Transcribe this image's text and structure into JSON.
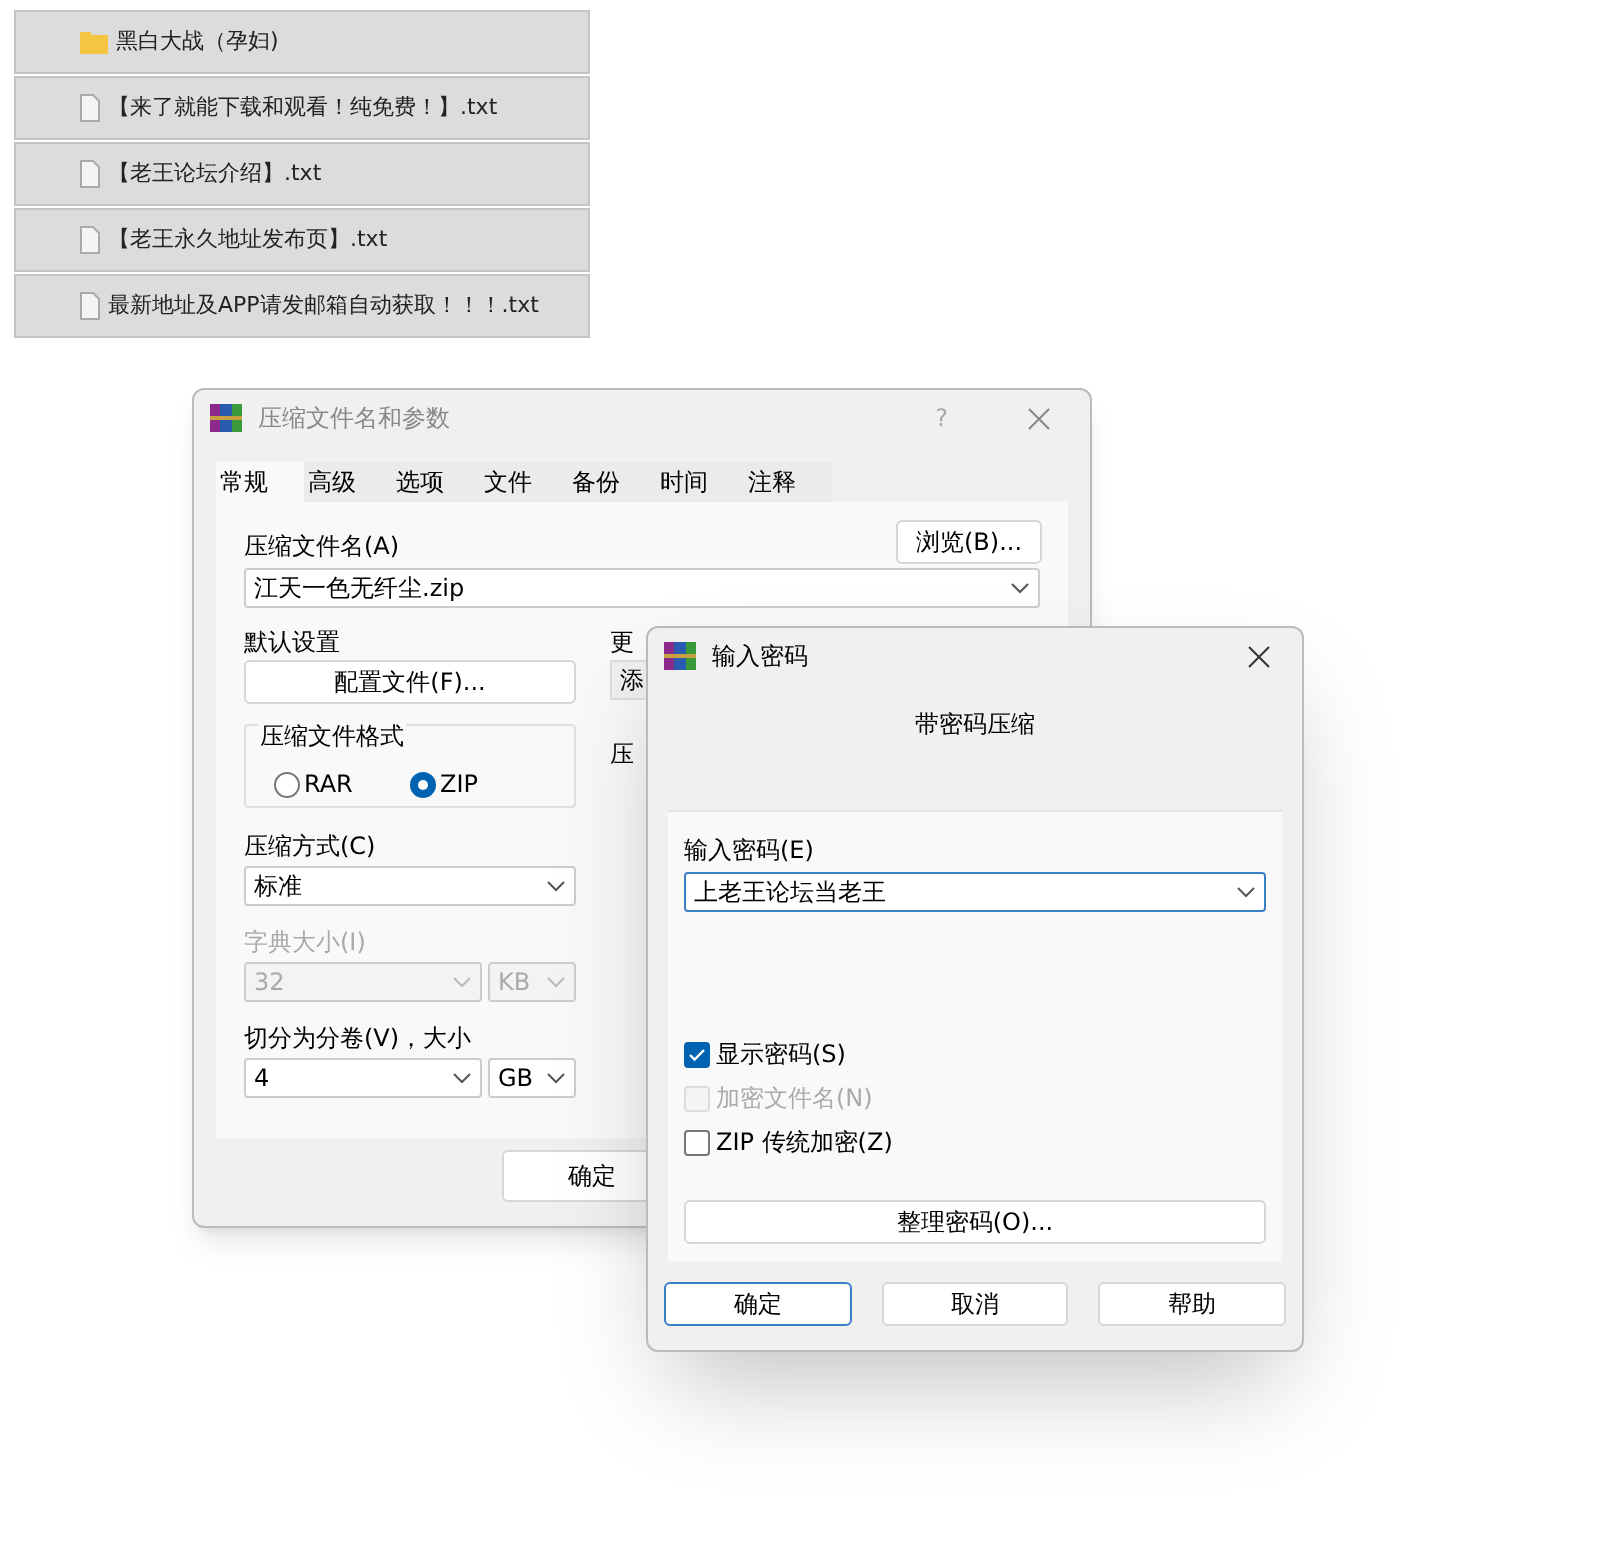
{
  "files": [
    {
      "kind": "folder",
      "name": "黑白大战（孕妇)"
    },
    {
      "kind": "file",
      "name": "【来了就能下载和观看！纯免费！】.txt"
    },
    {
      "kind": "file",
      "name": "【老王论坛介绍】.txt"
    },
    {
      "kind": "file",
      "name": "【老王永久地址发布页】.txt"
    },
    {
      "kind": "file",
      "name": "最新地址及APP请发邮箱自动获取！！！.txt"
    }
  ],
  "archive_dialog": {
    "title": "压缩文件名和参数",
    "help": "?",
    "tabs": [
      {
        "label": "常规",
        "selected": true
      },
      {
        "label": "高级",
        "selected": false
      },
      {
        "label": "选项",
        "selected": false
      },
      {
        "label": "文件",
        "selected": false
      },
      {
        "label": "备份",
        "selected": false
      },
      {
        "label": "时间",
        "selected": false
      },
      {
        "label": "注释",
        "selected": false
      }
    ],
    "archive_name_label": "压缩文件名(A)",
    "browse_button": "浏览(B)...",
    "archive_name": "江天一色无纤尘.zip",
    "default_settings_label": "默认设置",
    "profiles_button": "配置文件(F)...",
    "update_label": "更",
    "update_value": "添",
    "format_group": "压缩文件格式",
    "formats": [
      {
        "label": "RAR",
        "selected": false
      },
      {
        "label": "ZIP",
        "selected": true
      }
    ],
    "options_group": "压",
    "method_label": "压缩方式(C)",
    "method": "标准",
    "dictionary_label": "字典大小(I)",
    "dictionary": "32",
    "dictionary_unit": "KB",
    "dictionary_disabled": true,
    "split_label": "切分为分卷(V)，大小",
    "split": "4",
    "split_unit": "GB",
    "ok_button": "确定"
  },
  "password_dialog": {
    "title": "输入密码",
    "heading": "带密码压缩",
    "password_label": "输入密码(E)",
    "password": "上老王论坛当老王",
    "options": [
      {
        "label": "显示密码(S)",
        "checked": true,
        "disabled": false
      },
      {
        "label": "加密文件名(N)",
        "checked": false,
        "disabled": true
      },
      {
        "label": "ZIP 传统加密(Z)",
        "checked": false,
        "disabled": false
      }
    ],
    "organize_button": "整理密码(O)...",
    "buttons": [
      {
        "label": "确定",
        "selected": true
      },
      {
        "label": "取消",
        "selected": false
      },
      {
        "label": "帮助",
        "selected": false
      }
    ]
  }
}
